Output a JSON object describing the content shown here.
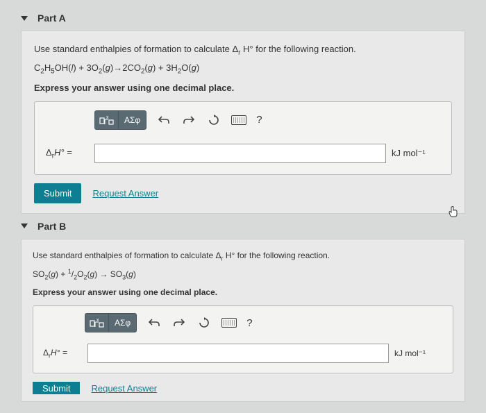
{
  "partA": {
    "title": "Part A",
    "prompt_prefix": "Use standard enthalpies of formation to calculate ",
    "prompt_symbol": "Δ",
    "prompt_sub": "r",
    "prompt_H": " H°",
    "prompt_suffix": " for the following reaction.",
    "equation_html": "C₂H₅OH(l) + 3O₂(g)→2CO₂(g) + 3H₂O(g)",
    "instruction": "Express your answer using one decimal place.",
    "toolbar_greek": "ΑΣφ",
    "help": "?",
    "label_delta": "Δ",
    "label_sub": "r",
    "label_H": "H° =",
    "answer_value": "",
    "unit": "kJ mol⁻¹",
    "submit": "Submit",
    "request": "Request Answer"
  },
  "partB": {
    "title": "Part B",
    "prompt_prefix": "Use standard enthalpies of formation to calculate ",
    "prompt_symbol": "Δ",
    "prompt_sub": "r",
    "prompt_H": " H°",
    "prompt_suffix": " for the following reaction.",
    "equation_html": "SO₂(g) + ½O₂(g) → SO₃(g)",
    "instruction": "Express your answer using one decimal place.",
    "toolbar_greek": "ΑΣφ",
    "help": "?",
    "label_delta": "Δ",
    "label_sub": "r",
    "label_H": "H° =",
    "answer_value": "",
    "unit": "kJ mol⁻¹",
    "submit": "Submit",
    "request": "Request Answer"
  }
}
